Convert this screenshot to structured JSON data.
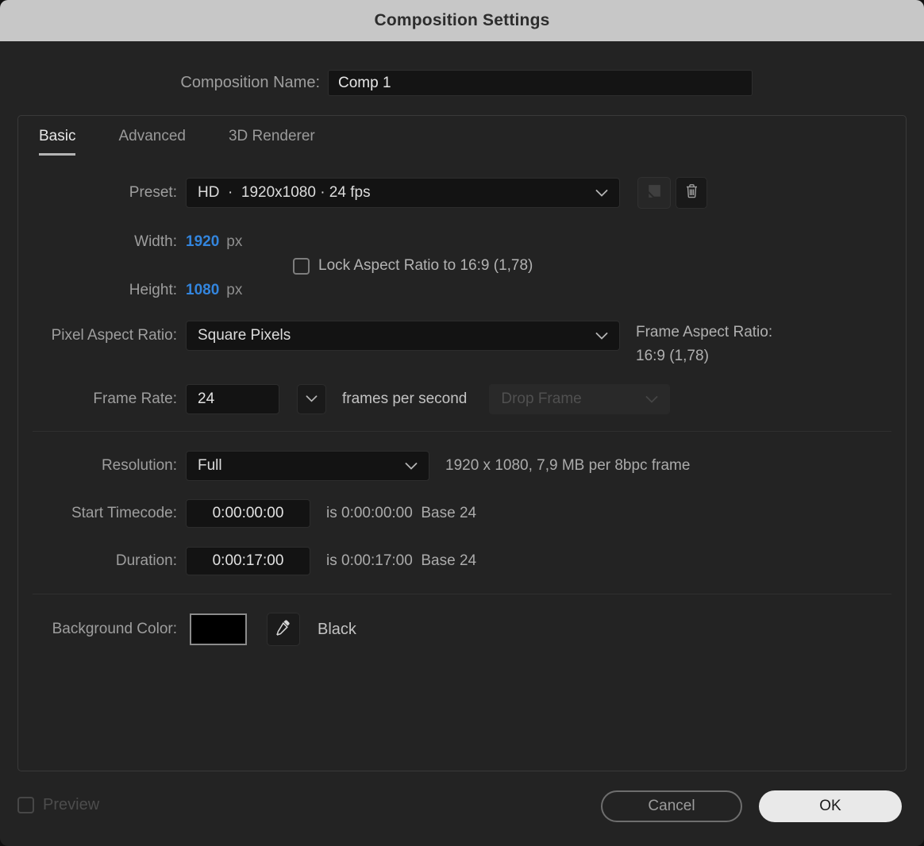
{
  "title": "Composition Settings",
  "name_row": {
    "label": "Composition Name:",
    "value": "Comp 1"
  },
  "tabs": [
    {
      "label": "Basic",
      "active": true
    },
    {
      "label": "Advanced",
      "active": false
    },
    {
      "label": "3D Renderer",
      "active": false
    }
  ],
  "preset": {
    "label": "Preset:",
    "value": "HD  ·  1920x1080 · 24 fps"
  },
  "dimensions": {
    "width_label": "Width:",
    "width_value": "1920",
    "width_unit": "px",
    "height_label": "Height:",
    "height_value": "1080",
    "height_unit": "px",
    "lock_label": "Lock Aspect Ratio to 16:9 (1,78)",
    "lock_checked": false
  },
  "pixel_aspect_ratio": {
    "label": "Pixel Aspect Ratio:",
    "value": "Square Pixels"
  },
  "frame_aspect_ratio": {
    "label": "Frame Aspect Ratio:",
    "value": "16:9 (1,78)"
  },
  "frame_rate": {
    "label": "Frame Rate:",
    "value": "24",
    "unit": "frames per second",
    "drop_frame_value": "Drop Frame",
    "drop_frame_enabled": false
  },
  "resolution": {
    "label": "Resolution:",
    "value": "Full",
    "info": "1920 x 1080, 7,9 MB per 8bpc frame"
  },
  "start_timecode": {
    "label": "Start Timecode:",
    "value": "0:00:00:00",
    "info": "is 0:00:00:00  Base 24"
  },
  "duration": {
    "label": "Duration:",
    "value": "0:00:17:00",
    "info": "is 0:00:17:00  Base 24"
  },
  "background_color": {
    "label": "Background Color:",
    "swatch_hex": "#000000",
    "color_name": "Black"
  },
  "footer": {
    "preview_label": "Preview",
    "preview_checked": false,
    "cancel_label": "Cancel",
    "ok_label": "OK"
  },
  "colors": {
    "accent_blue": "#3385dd",
    "titlebar": "#c7c7c7",
    "dialog_bg": "#232323",
    "swatch": "#000000"
  }
}
